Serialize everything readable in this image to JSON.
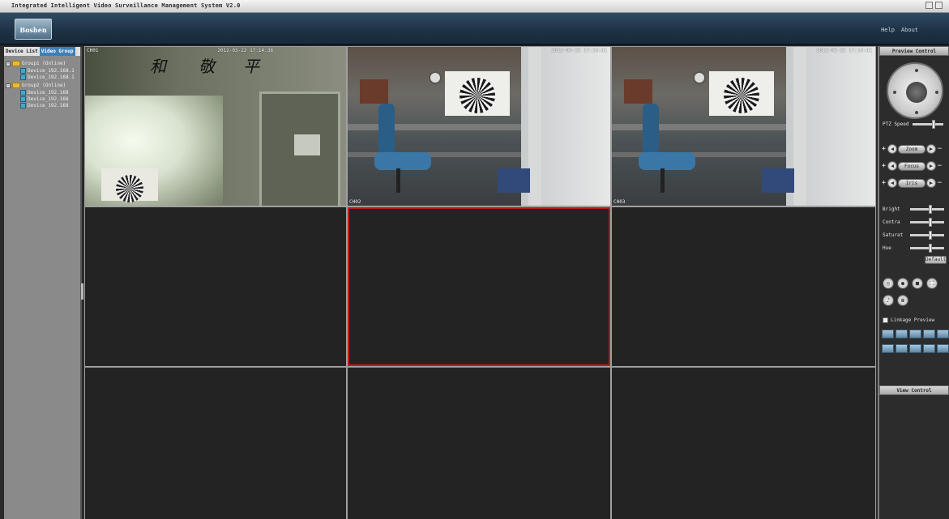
{
  "window": {
    "title": "Integrated Intelligent Video Surveillance Management System V2.0"
  },
  "header": {
    "logo_text": "Boshen",
    "links": [
      "Help",
      "About"
    ]
  },
  "left_panel": {
    "tabs": [
      "Device List",
      "Video Group"
    ],
    "tree": [
      {
        "name": "Group1 (Online)",
        "items": [
          "Device_192.168.1",
          "Device_192.168.1"
        ]
      },
      {
        "name": "Group2 (Online)",
        "items": [
          "Device_192.168",
          "Device_192.168",
          "Device_192.168"
        ]
      }
    ]
  },
  "video": {
    "cells": [
      {
        "title": "CH01",
        "timestamp": "2012-03-22 17:14:38",
        "label": ""
      },
      {
        "title": "",
        "timestamp": "2012-03-22 17:14:41",
        "label": "CH02"
      },
      {
        "title": "",
        "timestamp": "2012-03-22 17:14:41",
        "label": "CH03"
      }
    ]
  },
  "right_panel": {
    "preview_control": "Preview Control",
    "ptz_speed_label": "PTZ Speed",
    "ptz_speed": 0.7,
    "adjust": [
      "Zoom",
      "Focus",
      "Iris"
    ],
    "image": [
      {
        "label": "Bright",
        "value": 0.6
      },
      {
        "label": "Contra",
        "value": 0.6
      },
      {
        "label": "Saturat",
        "value": 0.6
      },
      {
        "label": "Hue",
        "value": 0.6
      }
    ],
    "default_label": "Default",
    "linkage_label": "Linkage Preview",
    "view_control": "View Control"
  },
  "colors": {
    "selected_cell": "#b81c1c",
    "banner": "#1e3246",
    "preset_button": "#5f87a6"
  }
}
